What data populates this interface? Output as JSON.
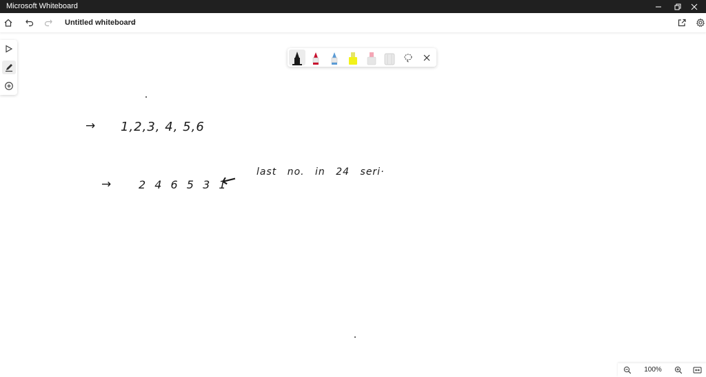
{
  "window": {
    "app_title": "Microsoft Whiteboard"
  },
  "appbar": {
    "board_title": "Untitled whiteboard",
    "icons": [
      "home-icon",
      "undo-icon",
      "redo-icon",
      "chevron-down-icon",
      "share-icon",
      "gear-icon"
    ]
  },
  "left_toolbar": {
    "tools": [
      "select-icon",
      "pen-icon",
      "add-icon"
    ],
    "active_tool": "pen"
  },
  "pen_toolbar": {
    "pens": [
      {
        "name": "black-pen",
        "color": "#1a1a1a"
      },
      {
        "name": "red-pen",
        "color": "#c8102e"
      },
      {
        "name": "blue-pen",
        "color": "#5b9bd5"
      },
      {
        "name": "yellow-highlighter",
        "color": "#f2f21a"
      },
      {
        "name": "pink-highlighter",
        "color": "#f4a6b5"
      },
      {
        "name": "eraser",
        "color": "#cfcfcf"
      }
    ],
    "active_pen": "black-pen",
    "actions": [
      "lasso-icon",
      "close-icon"
    ]
  },
  "canvas": {
    "ink": {
      "arrow1": "→",
      "line1": "1,2,3, 4, 5,6",
      "arrow2": "→",
      "line2": "2 4 6 5 3 1",
      "pointer": "←",
      "note": "last no. in 24 seri·"
    }
  },
  "zoom": {
    "level": "100%"
  },
  "colors": {
    "titlebar_bg": "#202020",
    "ink": "#1a1a1a"
  }
}
